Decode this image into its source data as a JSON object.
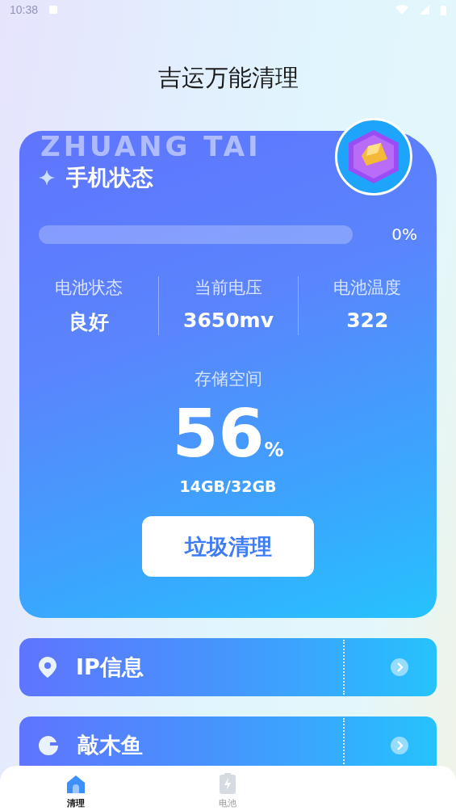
{
  "status_bar": {
    "time": "10:38"
  },
  "title": "吉运万能清理",
  "status_card": {
    "watermark": "ZHUANG TAI",
    "title": "手机状态",
    "progress": {
      "level": 0,
      "reading": "0%"
    },
    "stats": [
      {
        "label": "电池状态",
        "value": "良好"
      },
      {
        "label": "当前电压",
        "value": "3650mv"
      },
      {
        "label": "电池温度",
        "value": "322"
      }
    ],
    "storage": {
      "label": "存储空间",
      "percent": "56",
      "unit": "%",
      "detail": "14GB/32GB"
    },
    "button": "垃圾清理"
  },
  "features": [
    {
      "kind": "location",
      "label": "IP信息"
    },
    {
      "kind": "fish",
      "label": "敲木鱼"
    }
  ],
  "tabs": [
    {
      "kind": "home",
      "label": "清理",
      "selected": true
    },
    {
      "kind": "battery",
      "label": "电池",
      "selected": false
    }
  ]
}
